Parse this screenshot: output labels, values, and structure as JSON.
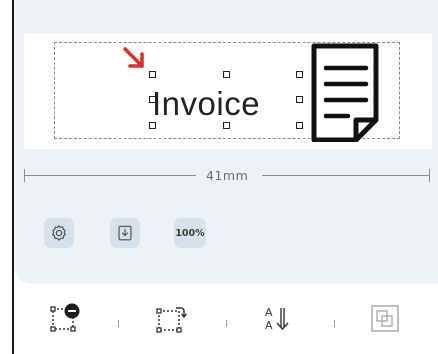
{
  "preview": {
    "text": "Invoice"
  },
  "dimension": {
    "label": "41mm"
  },
  "toolbar": {
    "settings_icon": "gear-icon",
    "save_icon": "save-download-icon",
    "zoom_label": "100%"
  },
  "bottom_toolbar": {
    "items": [
      {
        "icon": "remove-element-icon"
      },
      {
        "icon": "rotate-icon"
      },
      {
        "icon": "sort-text-az-icon"
      },
      {
        "icon": "layer-icon"
      }
    ]
  },
  "colors": {
    "panel_bg": "#eef1f5",
    "button_bg": "#d7e1eb",
    "arrow": "#d9302c"
  }
}
